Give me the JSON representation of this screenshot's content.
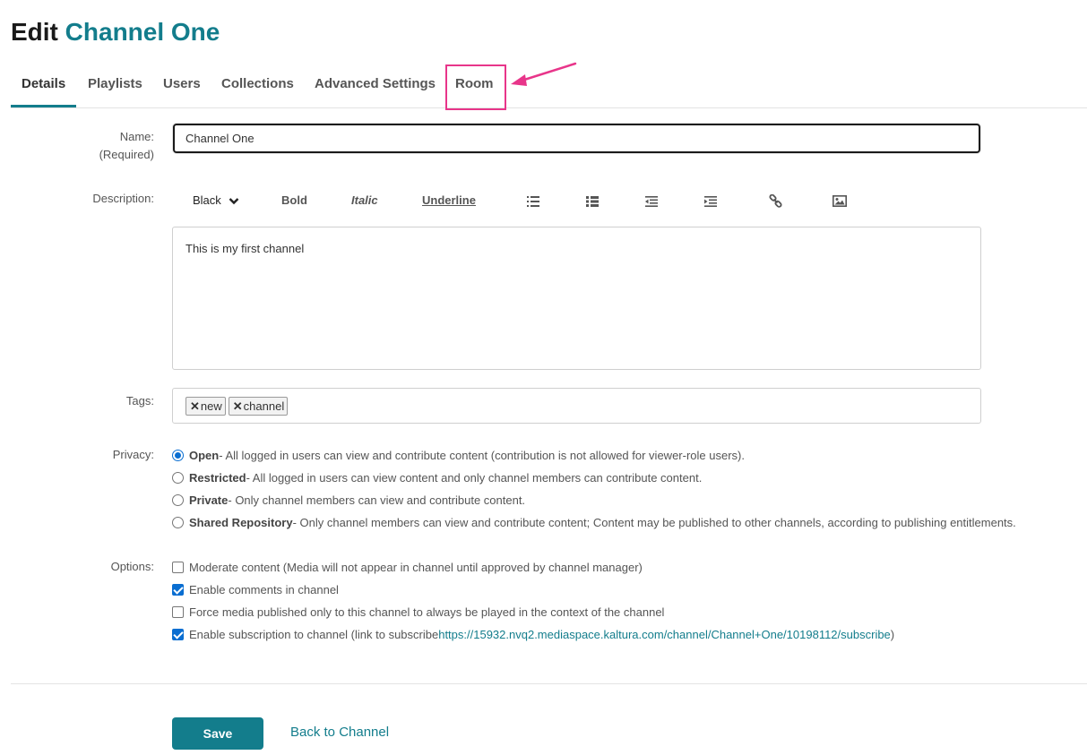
{
  "header": {
    "prefix": "Edit",
    "channel_name": "Channel One"
  },
  "tabs": [
    {
      "label": "Details",
      "active": true
    },
    {
      "label": "Playlists"
    },
    {
      "label": "Users"
    },
    {
      "label": "Collections"
    },
    {
      "label": "Advanced Settings"
    },
    {
      "label": "Room",
      "highlighted": true
    }
  ],
  "form": {
    "name_label": "Name:",
    "name_required": "(Required)",
    "name_value": "Channel One",
    "description_label": "Description:",
    "toolbar": {
      "color": "Black",
      "bold": "Bold",
      "italic": "Italic",
      "underline": "Underline",
      "icons": [
        "unordered-list-icon",
        "ordered-list-icon",
        "outdent-icon",
        "indent-icon",
        "link-icon",
        "image-icon"
      ]
    },
    "description_value": "This is my first channel",
    "tags_label": "Tags:",
    "tags": [
      "new",
      "channel"
    ],
    "tag_remove_glyph": "✕",
    "privacy_label": "Privacy:",
    "privacy_options": [
      {
        "name": "Open",
        "desc": " - All logged in users can view and contribute content (contribution is not allowed for viewer-role users).",
        "checked": true
      },
      {
        "name": "Restricted",
        "desc": " - All logged in users can view content and only channel members can contribute content.",
        "checked": false
      },
      {
        "name": "Private",
        "desc": " - Only channel members can view and contribute content.",
        "checked": false
      },
      {
        "name": "Shared Repository",
        "desc": " - Only channel members can view and contribute content; Content may be published to other channels, according to publishing entitlements.",
        "checked": false
      }
    ],
    "options_label": "Options:",
    "options": [
      {
        "text": "Moderate content (Media will not appear in channel until approved by channel manager)",
        "checked": false
      },
      {
        "text": "Enable comments in channel",
        "checked": true
      },
      {
        "text": "Force media published only to this channel to always be played in the context of the channel",
        "checked": false
      },
      {
        "text": "Enable subscription to channel (link to subscribe ",
        "link": "https://15932.nvq2.mediaspace.kaltura.com/channel/Channel+One/10198112/subscribe",
        "suffix": ")",
        "checked": true
      }
    ]
  },
  "actions": {
    "save": "Save",
    "back": "Back to Channel"
  },
  "colors": {
    "accent": "#137d8c",
    "highlight": "#e8358a",
    "checkbox": "#0a6ed1"
  }
}
